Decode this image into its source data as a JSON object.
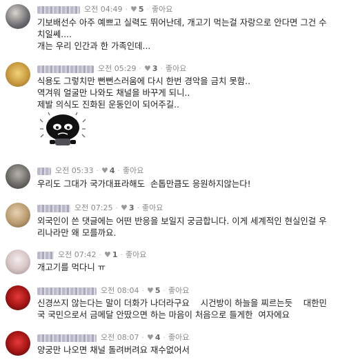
{
  "like_label": "좋아요",
  "comments": [
    {
      "time": "오전 04:49",
      "likes": "5",
      "text": "기보배선수 아주 예쁘고 실력도 뛰어난데, 개고기 먹는걸 자랑으로 안다면 그건 수\n치일쎄....\n개는 우리 인간과 한 가족인데..."
    },
    {
      "time": "오전 05:29",
      "likes": "3",
      "text": "식용도 그렇치만 뻔뻔스러움에 다시 한번 경악을 금치 못함..\n역겨워 얼굴만 나와도 채널을 바꾸게 되니..\n제발 의식도 진화된 운동인이 되어주길.."
    },
    {
      "time": "오전 05:33",
      "likes": "4",
      "text": "우리도 그대가 국가대표라해도  손톱만큼도 응원하지않는다!"
    },
    {
      "time": "오전 07:25",
      "likes": "3",
      "text": "외국인이 쓴 댓글에는 어떤 반응을 보일지 궁금합니다. 이게 세계적인 현실인걸 우\n리나라만 왜 모를까요."
    },
    {
      "time": "오전 07:42",
      "likes": "1",
      "text": "개고기를 먹다니 ㅠ"
    },
    {
      "time": "오전 08:04",
      "likes": "5",
      "text": "신경쓰지 않는다는 말이 더화가 나더라구요    시건방이 하늘을 찌르는듯    대한민\n국 국민으로서 금메달 안땄으면 하는 마음이 처음으로 들게한  여자에요"
    },
    {
      "time": "오전 08:07",
      "likes": "4",
      "text": "양궁만 나오면 채널 돌려버려요 재수없어서"
    }
  ]
}
